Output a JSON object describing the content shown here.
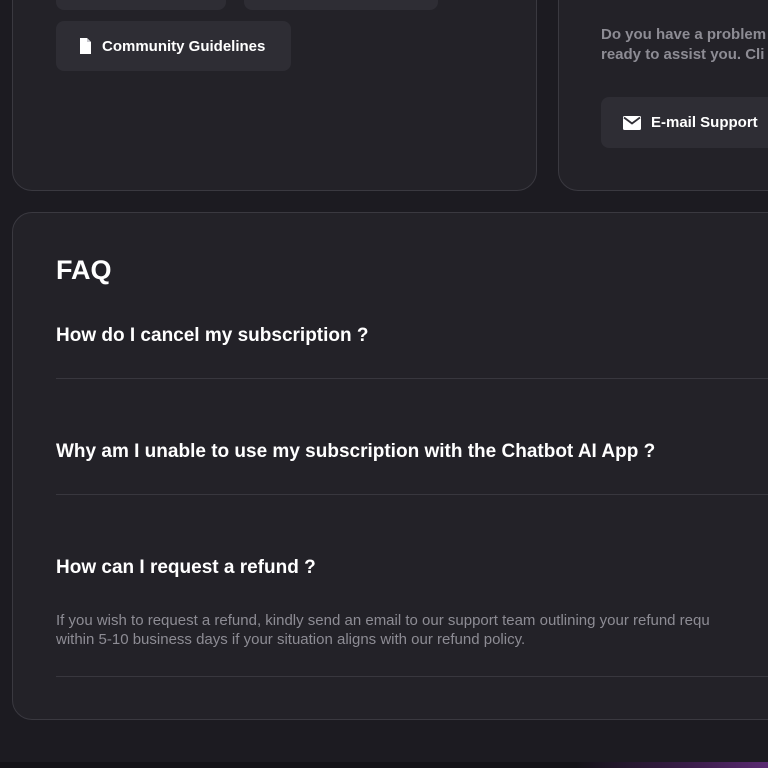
{
  "top_cards": {
    "guidelines_button": {
      "label": "Community Guidelines",
      "icon": "document-icon"
    },
    "support": {
      "text_line_1": "Do you have a problem",
      "text_line_2": "ready to assist you. Cli",
      "email_button": {
        "label": "E-mail Support",
        "icon": "envelope-icon"
      }
    }
  },
  "faq": {
    "title": "FAQ",
    "items": [
      {
        "question": "How do I cancel my subscription ?"
      },
      {
        "question": "Why am I unable to use my subscription with the Chatbot AI App ?"
      },
      {
        "question": "How can I request a refund ?",
        "answer_line_1": "If you wish to request a refund, kindly send an email to our support team outlining your refund requ",
        "answer_line_2": "within 5-10 business days if your situation aligns with our refund policy."
      }
    ]
  },
  "colors": {
    "background": "#1c1b21",
    "card": "#232228",
    "button": "#2e2d34",
    "border": "#3a3940",
    "muted_text": "#8d8c94",
    "primary_text": "#ffffff"
  }
}
